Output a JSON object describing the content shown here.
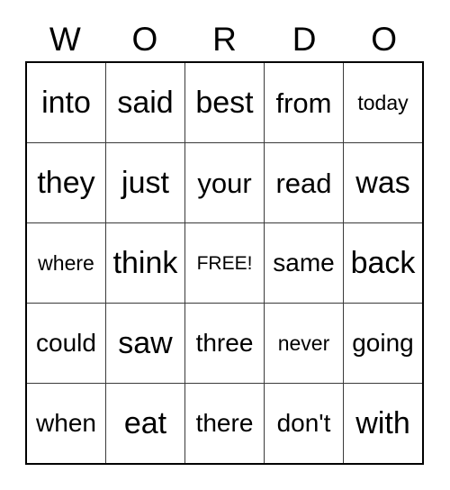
{
  "card": {
    "header_letters": [
      "W",
      "O",
      "R",
      "D",
      "O"
    ],
    "rows": [
      [
        {
          "text": "into",
          "size": "xl"
        },
        {
          "text": "said",
          "size": "xl"
        },
        {
          "text": "best",
          "size": "xl"
        },
        {
          "text": "from",
          "size": "lg"
        },
        {
          "text": "today",
          "size": "sm"
        }
      ],
      [
        {
          "text": "they",
          "size": "xl"
        },
        {
          "text": "just",
          "size": "xl"
        },
        {
          "text": "your",
          "size": "lg"
        },
        {
          "text": "read",
          "size": "lg"
        },
        {
          "text": "was",
          "size": "xl"
        }
      ],
      [
        {
          "text": "where",
          "size": "sm"
        },
        {
          "text": "think",
          "size": "xl"
        },
        {
          "text": "FREE!",
          "size": "xs"
        },
        {
          "text": "same",
          "size": "md"
        },
        {
          "text": "back",
          "size": "xl"
        }
      ],
      [
        {
          "text": "could",
          "size": "md"
        },
        {
          "text": "saw",
          "size": "xl"
        },
        {
          "text": "three",
          "size": "md"
        },
        {
          "text": "never",
          "size": "sm"
        },
        {
          "text": "going",
          "size": "md"
        }
      ],
      [
        {
          "text": "when",
          "size": "md"
        },
        {
          "text": "eat",
          "size": "xl"
        },
        {
          "text": "there",
          "size": "md"
        },
        {
          "text": "don't",
          "size": "md"
        },
        {
          "text": "with",
          "size": "xl"
        }
      ]
    ],
    "free_space": {
      "label": "FREE!",
      "row": 2,
      "column": 2
    },
    "colors": {
      "background": "#ffffff",
      "text": "#000000",
      "outer_border": "#000000",
      "inner_border": "#3a3a3a"
    }
  }
}
